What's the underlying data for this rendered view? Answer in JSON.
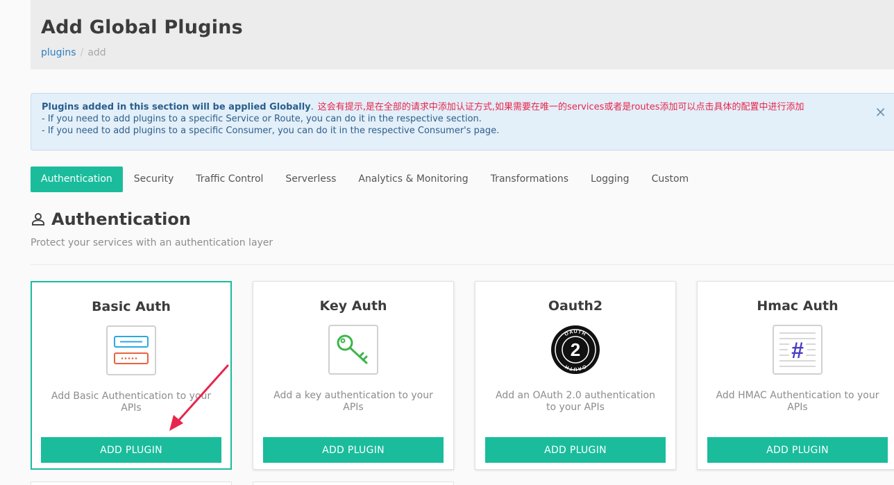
{
  "header": {
    "title": "Add Global Plugins",
    "breadcrumb": {
      "link": "plugins",
      "separator": "/",
      "current": "add"
    }
  },
  "alert": {
    "strong": "Plugins added in this section will be applied Globally",
    "strong_suffix": ".",
    "note": "这会有提示,是在全部的请求中添加认证方式,如果需要在唯一的services或者是routes添加可以点击具体的配置中进行添加",
    "line1": "- If you need to add plugins to a specific Service or Route, you can do it in the respective section.",
    "line2": "- If you need to add plugins to a specific Consumer, you can do it in the respective Consumer's page.",
    "close_icon": "×"
  },
  "tabs": [
    {
      "label": "Authentication",
      "active": true
    },
    {
      "label": "Security"
    },
    {
      "label": "Traffic Control"
    },
    {
      "label": "Serverless"
    },
    {
      "label": "Analytics & Monitoring"
    },
    {
      "label": "Transformations"
    },
    {
      "label": "Logging"
    },
    {
      "label": "Custom"
    }
  ],
  "section": {
    "icon": "person-icon",
    "title": "Authentication",
    "subtitle": "Protect your services with an authentication layer"
  },
  "cards": [
    {
      "title": "Basic Auth",
      "icon": "basic-auth-icon",
      "description": "Add Basic Authentication to your APIs",
      "button": "ADD PLUGIN",
      "selected": true
    },
    {
      "title": "Key Auth",
      "icon": "key-icon",
      "description": "Add a key authentication to your APIs",
      "button": "ADD PLUGIN"
    },
    {
      "title": "Oauth2",
      "icon": "oauth2-icon",
      "icon_text": "2",
      "icon_ring_text": "OAUTH",
      "description": "Add an OAuth 2.0 authentication to your APIs",
      "button": "ADD PLUGIN"
    },
    {
      "title": "Hmac Auth",
      "icon": "hmac-icon",
      "icon_text": "#",
      "description": "Add HMAC Authentication to your APIs",
      "button": "ADD PLUGIN"
    }
  ],
  "colors": {
    "accent": "#1abc9c",
    "link": "#2d7fc1",
    "annotation": "#e8254c"
  }
}
